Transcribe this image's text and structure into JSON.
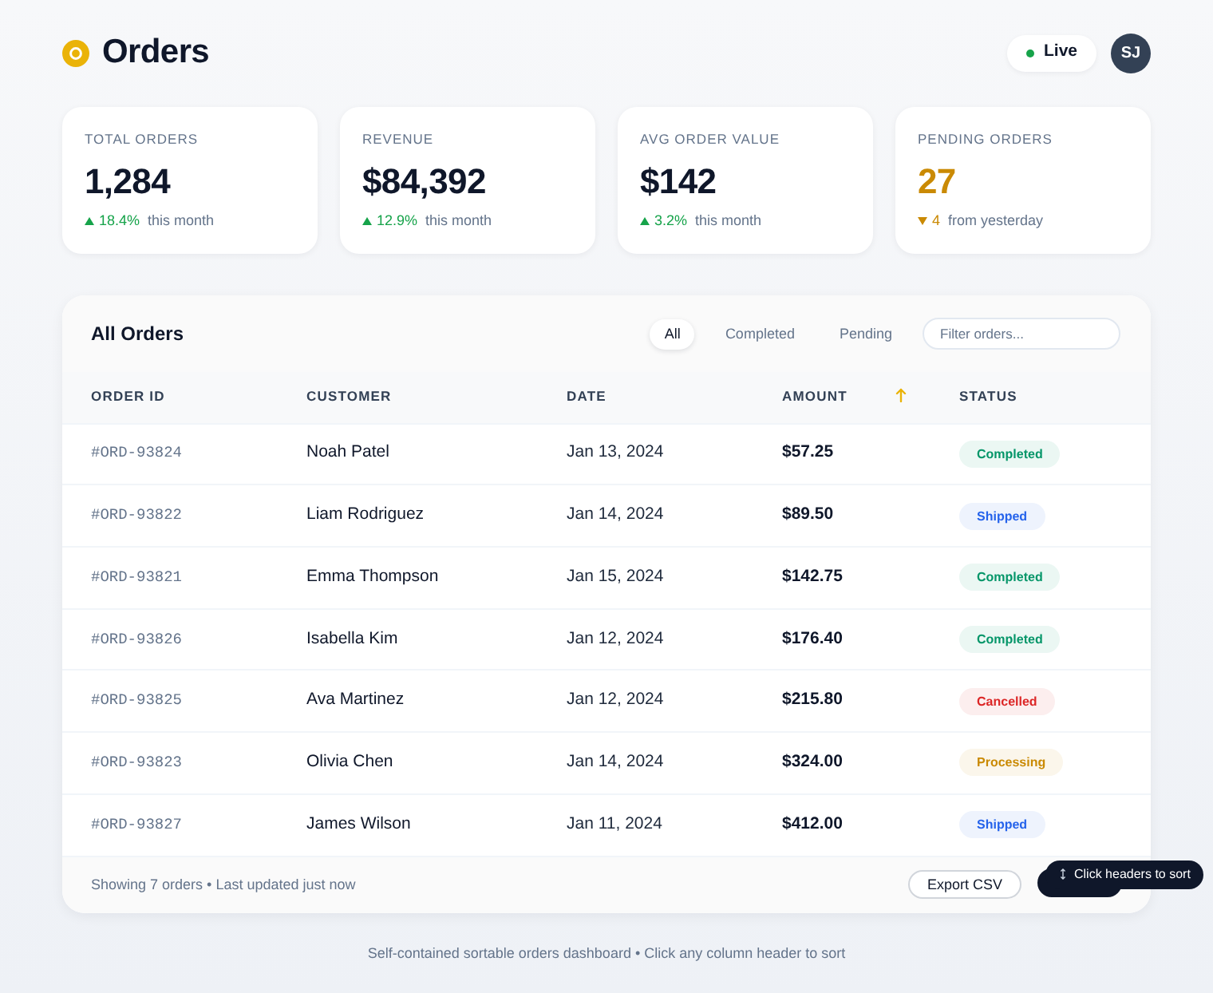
{
  "header": {
    "title": "Orders",
    "live": {
      "label": "Live",
      "online": true
    },
    "avatar": "SJ"
  },
  "stats": [
    {
      "label": "TOTAL ORDERS",
      "value": "1,284",
      "rising": true,
      "change": "18.4%",
      "note": "this month",
      "highlight": false
    },
    {
      "label": "REVENUE",
      "value": "$84,392",
      "rising": true,
      "change": "12.9%",
      "note": "this month",
      "highlight": false
    },
    {
      "label": "AVG ORDER VALUE",
      "value": "$142",
      "rising": true,
      "change": "3.2%",
      "note": "this month",
      "highlight": false
    },
    {
      "label": "PENDING ORDERS",
      "value": "27",
      "rising": false,
      "change": "4",
      "note": "from yesterday",
      "highlight": true
    }
  ],
  "orders": {
    "title": "All Orders",
    "filters": [
      {
        "label": "All",
        "selected": true
      },
      {
        "label": "Completed",
        "selected": false
      },
      {
        "label": "Pending",
        "selected": false
      }
    ],
    "search": {
      "placeholder": "Filter orders..."
    },
    "sort_ascending": true,
    "columns": [
      {
        "label": "ORDER ID",
        "sorted": false
      },
      {
        "label": "CUSTOMER",
        "sorted": false
      },
      {
        "label": "DATE",
        "sorted": false
      },
      {
        "label": "AMOUNT",
        "sorted": true
      },
      {
        "label": "STATUS",
        "sorted": false
      }
    ],
    "rows": [
      {
        "order_id": "#ORD-93824",
        "customer": "Noah Patel",
        "date": "Jan 13, 2024",
        "amount": "$57.25",
        "status": "Completed",
        "color": "#059669"
      },
      {
        "order_id": "#ORD-93822",
        "customer": "Liam Rodriguez",
        "date": "Jan 14, 2024",
        "amount": "$89.50",
        "status": "Shipped",
        "color": "#2563eb"
      },
      {
        "order_id": "#ORD-93821",
        "customer": "Emma Thompson",
        "date": "Jan 15, 2024",
        "amount": "$142.75",
        "status": "Completed",
        "color": "#059669"
      },
      {
        "order_id": "#ORD-93826",
        "customer": "Isabella Kim",
        "date": "Jan 12, 2024",
        "amount": "$176.40",
        "status": "Completed",
        "color": "#059669"
      },
      {
        "order_id": "#ORD-93825",
        "customer": "Ava Martinez",
        "date": "Jan 12, 2024",
        "amount": "$215.80",
        "status": "Cancelled",
        "color": "#dc2626"
      },
      {
        "order_id": "#ORD-93823",
        "customer": "Olivia Chen",
        "date": "Jan 14, 2024",
        "amount": "$324.00",
        "status": "Processing",
        "color": "#ca8a04"
      },
      {
        "order_id": "#ORD-93827",
        "customer": "James Wilson",
        "date": "Jan 11, 2024",
        "amount": "$412.00",
        "status": "Shipped",
        "color": "#2563eb"
      }
    ],
    "footer": {
      "summary": "Showing 7 orders • Last updated just now",
      "buttons": [
        {
          "kind": "outline",
          "label": "Export CSV"
        },
        {
          "kind": "solid"
        }
      ],
      "tooltip": "Click headers to sort"
    }
  },
  "caption": "Self-contained sortable orders dashboard • Click any column header to sort"
}
